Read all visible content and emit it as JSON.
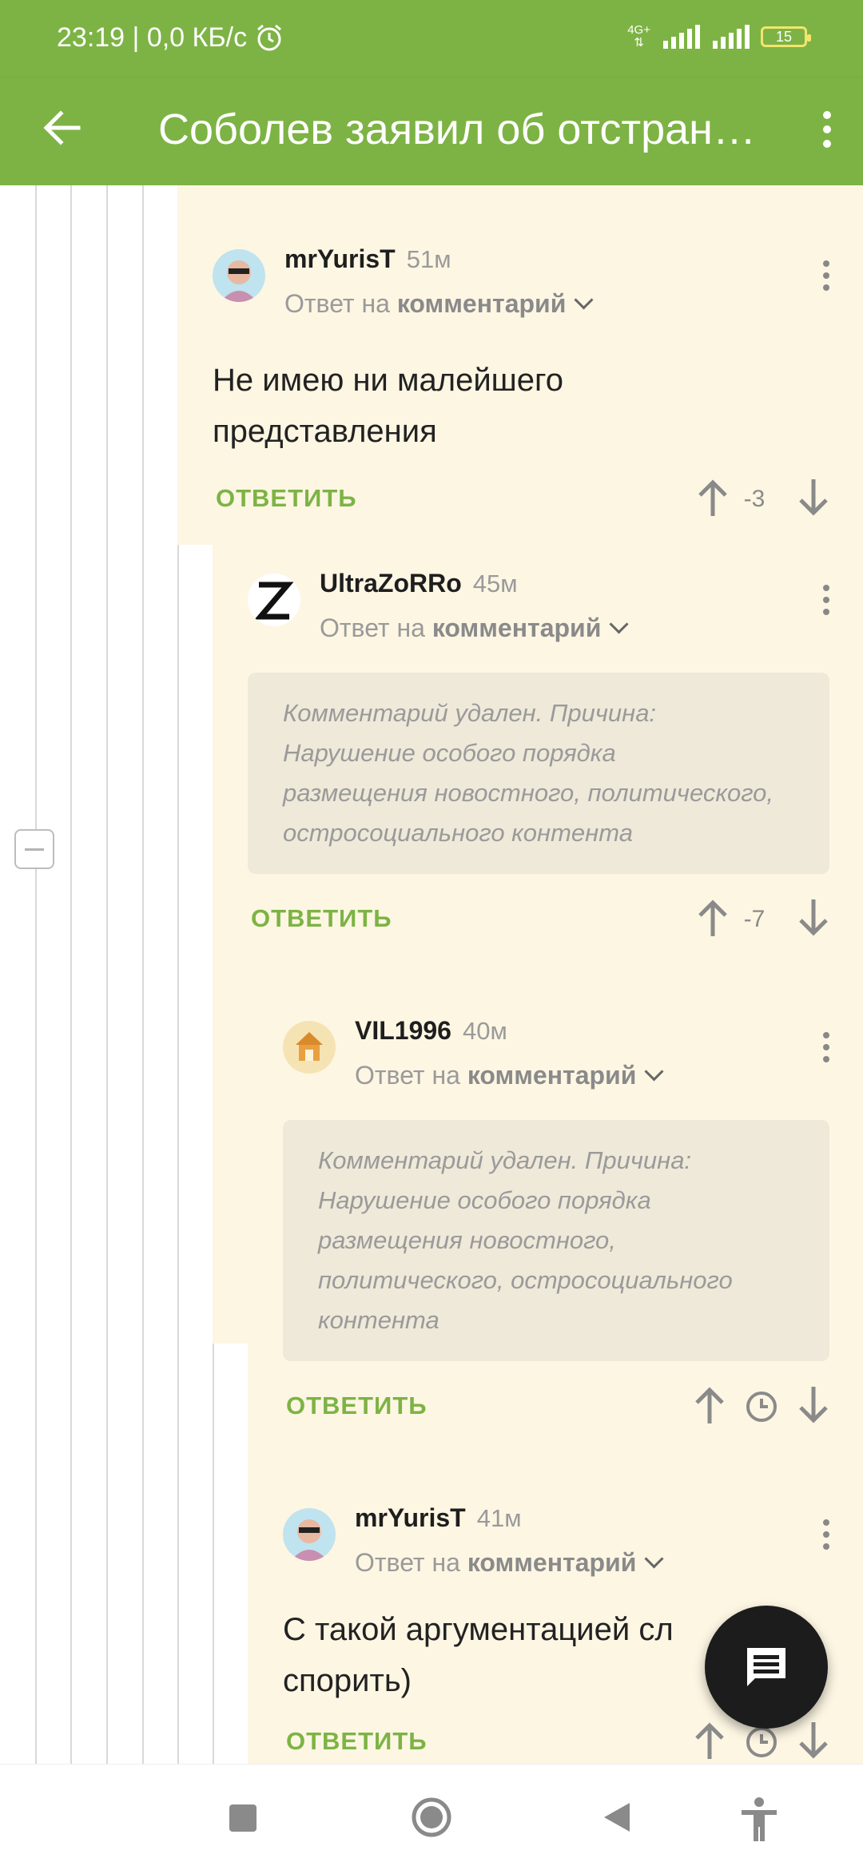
{
  "status": {
    "time": "23:19",
    "speed": "0,0 КБ/с",
    "network": "4G+",
    "battery": "15"
  },
  "appbar": {
    "title": "Соболев заявил об отстранении"
  },
  "comments": [
    {
      "author": "mrYurisT",
      "time": "51м",
      "reply_prefix": "Ответ на",
      "reply_target": "комментарий",
      "text_lines": [
        "Не имею ни малейшего",
        "представления"
      ],
      "reply_label": "ОТВЕТИТЬ",
      "score": "-3"
    },
    {
      "author": "UltraZoRRo",
      "time": "45м",
      "reply_prefix": "Ответ на",
      "reply_target": "комментарий",
      "deleted_lines": [
        "Комментарий удален. Причина:",
        "Нарушение особого порядка",
        "размещения новостного, политического,",
        "остросоциального контента"
      ],
      "reply_label": "ОТВЕТИТЬ",
      "score": "-7"
    },
    {
      "author": "VIL1996",
      "time": "40м",
      "reply_prefix": "Ответ на",
      "reply_target": "комментарий",
      "deleted_lines": [
        "Комментарий удален. Причина:",
        "Нарушение особого порядка",
        "размещения новостного,",
        "политического, остросоциального",
        "контента"
      ],
      "reply_label": "ОТВЕТИТЬ"
    },
    {
      "author": "mrYurisT",
      "time": "41м",
      "reply_prefix": "Ответ на",
      "reply_target": "комментарий",
      "text_lines": [
        "С такой аргументацией сл",
        "спорить)"
      ],
      "reply_label": "ОТВЕТИТЬ"
    }
  ],
  "colors": {
    "brand_green": "#7db344",
    "comment_bg": "#fdf6e3",
    "deleted_bg": "#efe9d9"
  },
  "icons": [
    "back-arrow-icon",
    "more-vertical-icon",
    "alarm-icon",
    "upvote-icon",
    "downvote-icon",
    "clock-icon",
    "chat-icon",
    "recents-icon",
    "home-icon",
    "back-icon",
    "accessibility-icon"
  ]
}
